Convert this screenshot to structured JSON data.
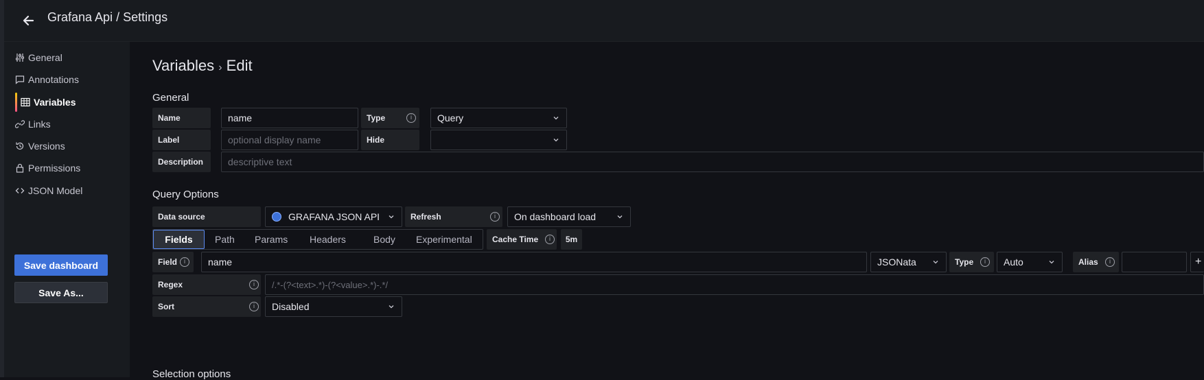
{
  "header": {
    "title": "Grafana Api / Settings"
  },
  "sidebar": {
    "items": [
      {
        "label": "General",
        "icon": "sliders-icon"
      },
      {
        "label": "Annotations",
        "icon": "comment-icon"
      },
      {
        "label": "Variables",
        "icon": "table-icon",
        "active": true
      },
      {
        "label": "Links",
        "icon": "link-icon"
      },
      {
        "label": "Versions",
        "icon": "history-icon"
      },
      {
        "label": "Permissions",
        "icon": "lock-icon"
      },
      {
        "label": "JSON Model",
        "icon": "code-icon"
      }
    ],
    "save_label": "Save dashboard",
    "save_as_label": "Save As..."
  },
  "main": {
    "title": "Variables",
    "title_sep": "›",
    "title_edit": "Edit",
    "general": {
      "heading": "General",
      "name_label": "Name",
      "name_value": "name",
      "type_label": "Type",
      "type_value": "Query",
      "label_label": "Label",
      "label_placeholder": "optional display name",
      "hide_label": "Hide",
      "hide_value": "",
      "description_label": "Description",
      "description_placeholder": "descriptive text"
    },
    "query_options": {
      "heading": "Query Options",
      "datasource_label": "Data source",
      "datasource_value": "GRAFANA JSON API",
      "refresh_label": "Refresh",
      "refresh_value": "On dashboard load",
      "tabs": [
        "Fields",
        "Path",
        "Params",
        "Headers",
        "Body",
        "Experimental"
      ],
      "active_tab": "Fields",
      "cache_time_label": "Cache Time",
      "cache_time_value": "5m",
      "field_label": "Field",
      "field_value": "name",
      "field_language": "JSONata",
      "field_type_label": "Type",
      "field_type_value": "Auto",
      "alias_label": "Alias",
      "alias_value": "",
      "add_symbol": "+",
      "regex_label": "Regex",
      "regex_placeholder": "/.*-(?<text>.*)-(?<value>.*)-.*/",
      "sort_label": "Sort",
      "sort_value": "Disabled"
    },
    "selection_heading": "Selection options"
  },
  "colors": {
    "accent": "#3d71d9",
    "background": "#111217",
    "panel": "#181b1f",
    "active_bar": "#ff8833"
  }
}
